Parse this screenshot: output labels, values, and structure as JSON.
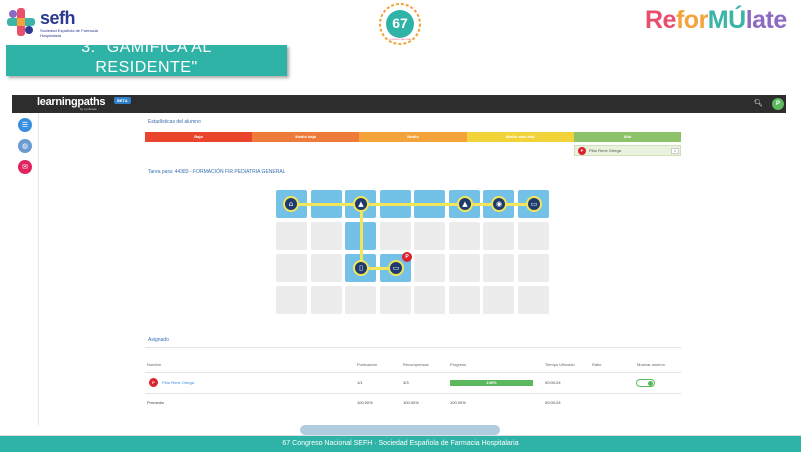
{
  "slide": {
    "sefh_logo": {
      "word": "sefh",
      "subtitle": "Sociedad Española de Farmacia Hospitalaria"
    },
    "congress_badge": {
      "number": "67",
      "caption": "CONGRESO NACIONAL"
    },
    "reformulate_logo": {
      "parts": [
        "Re",
        "for",
        "MÚ",
        "late"
      ]
    },
    "banner": {
      "line1": "3. \"GAMIFICA AL",
      "line2": "RESIDENTE\""
    },
    "footer": "67 Congreso Nacional SEFH · Sociedad Española de Farmacia Hospitalaria"
  },
  "app": {
    "brand": "learningpaths",
    "brand_sub": "by symbiose",
    "beta_badge": "BETA",
    "topbar_icons": [
      "search-icon",
      "user-avatar"
    ],
    "avatar_initial": "P",
    "sidebar_icons": [
      "chat-icon",
      "globe-icon",
      "mail-icon"
    ],
    "stats_title": "Estadísticas del alumno",
    "levels": [
      {
        "label": "Bajo",
        "color": "#e8452c"
      },
      {
        "label": "Medio bajo",
        "color": "#ef7b3a"
      },
      {
        "label": "Medio",
        "color": "#f4a33a"
      },
      {
        "label": "Medio más alto",
        "color": "#f2d33a"
      },
      {
        "label": "Alto",
        "color": "#8cc36a"
      }
    ],
    "student": {
      "initial": "P",
      "name": "Pilar Rene Ortega",
      "edit": "✎"
    },
    "course_title": "Tarea para: 44383 - FORMACIÓN FIR PEDIATRIA GENERAL",
    "map_pin": "P",
    "map_nodes": [
      "home-icon",
      "graduation-cap-icon",
      "graduation-cap-icon",
      "compass-icon",
      "ticket-icon",
      "clipboard-icon",
      "ticket-icon"
    ],
    "assigned_title": "Asignado",
    "table": {
      "headers": [
        "Nombre",
        "Puntuación",
        "Recompensas",
        "Progreso",
        "Tiempo Utilizado",
        "Ratio",
        "Mostrar alumno"
      ],
      "row": {
        "initial": "P",
        "name": "Pilar Rene Ortega",
        "score": "1/1",
        "rewards": "3/3",
        "progress": "100%",
        "progress_fraction": 1.0,
        "time": "00:00:24",
        "ratio": "",
        "show_student": true
      },
      "average": {
        "label": "Promedio",
        "score": "100.00%",
        "rewards": "100.00%",
        "progress": "100.00%",
        "time": "00:00:24"
      }
    }
  }
}
